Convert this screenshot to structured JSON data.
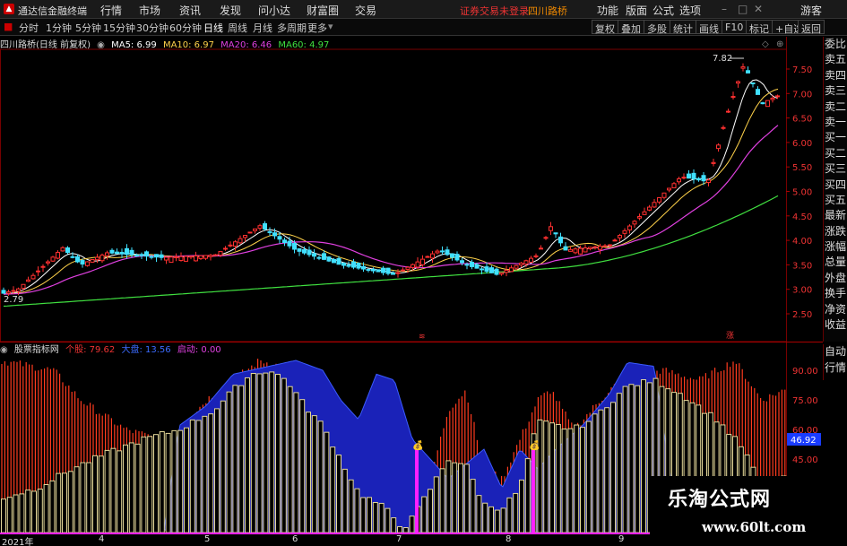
{
  "menu": {
    "app_title": "通达信金融终端",
    "items": [
      "行情",
      "市场",
      "资讯",
      "发现",
      "问小达",
      "财富圈",
      "交易"
    ],
    "login_notice": "证券交易未登录",
    "stock": "四川路桥",
    "right_items": [
      "功能",
      "版面",
      "公式",
      "选项"
    ],
    "info": "游客"
  },
  "toolbar": {
    "periods": [
      "分时",
      "1分钟",
      "5分钟",
      "15分钟",
      "30分钟",
      "60分钟",
      "日线",
      "周线",
      "月线",
      "多周期",
      "更多"
    ],
    "active": "日线",
    "right_buttons": [
      "复权",
      "叠加",
      "多股",
      "统计",
      "画线",
      "F10",
      "标记",
      "+自选",
      "返回"
    ]
  },
  "main_info": {
    "title": "四川路桥(日线 前复权)",
    "ma5": "MA5: 6.99",
    "ma10": "MA10: 6.97",
    "ma20": "MA20: 6.46",
    "ma60": "MA60: 4.97",
    "colors": {
      "ma5": "#ffffff",
      "ma10": "#ffd24a",
      "ma20": "#e040e0",
      "ma60": "#40e040"
    }
  },
  "price_axis": [
    "7.50",
    "7.00",
    "6.50",
    "6.00",
    "5.50",
    "5.00",
    "4.50",
    "4.00",
    "3.50",
    "3.00",
    "2.50"
  ],
  "high_label": "7.82",
  "low_label": "2.79",
  "right_panel": [
    "委比",
    "卖五",
    "卖四",
    "卖三",
    "卖二",
    "卖一",
    "买一",
    "买二",
    "买三",
    "买四",
    "买五",
    "最新",
    "涨跌",
    "涨幅",
    "总量",
    "外盘",
    "换手",
    "净资",
    "收益"
  ],
  "right_panel2": [
    "自动",
    "行情"
  ],
  "indicator": {
    "name": "股票指标网",
    "stock_label": "个股: 79.62",
    "market_label": "大盘: 13.56",
    "auto_label": "启动: 0.00",
    "axis": [
      "90.00",
      "75.00",
      "60.00",
      "45.00"
    ],
    "current_value": "46.92"
  },
  "dates": [
    "2021年",
    "4",
    "5",
    "6",
    "7",
    "8",
    "9"
  ],
  "watermark": {
    "cn": "乐淘公式网",
    "url": "www.60lt.com"
  }
}
